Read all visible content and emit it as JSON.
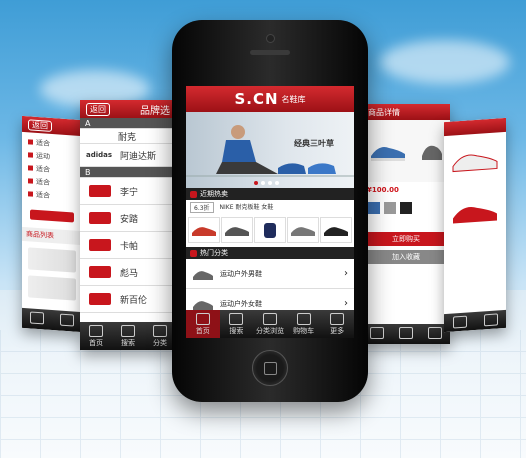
{
  "brand_logo": "S.CN",
  "brand_sub": "名鞋库",
  "banner": {
    "text1": "经典三叶草"
  },
  "hot": {
    "header": "近期热卖",
    "tabs": [
      "6.3折",
      "NIKE 耐克板鞋 女鞋"
    ]
  },
  "category": {
    "header": "热门分类",
    "items": [
      "运动户外男鞋",
      "运动户外女鞋"
    ]
  },
  "tabbar": [
    "首页",
    "搜索",
    "分类浏览",
    "购物车",
    "更多"
  ],
  "left_brands": {
    "back": "返回",
    "title": "品牌选",
    "section_a": "A",
    "section_b": "B",
    "items": [
      "耐克",
      "阿迪达斯",
      "李宁",
      "安踏",
      "卡帕",
      "彪马",
      "新百伦"
    ],
    "tabs": [
      "首页",
      "搜索",
      "分类"
    ]
  },
  "far_left": {
    "back": "返回",
    "lines": [
      "适合",
      "运动",
      "适合",
      "适合",
      "适合"
    ],
    "section": "商品列表"
  },
  "right_detail": {
    "title": "商品详情",
    "button_buy": "立即购买",
    "button_fav": "加入收藏",
    "price": "¥100.00"
  },
  "colors": {
    "accent_red": "#c8161d",
    "dark": "#111111",
    "sky": "#4aa3dc"
  }
}
